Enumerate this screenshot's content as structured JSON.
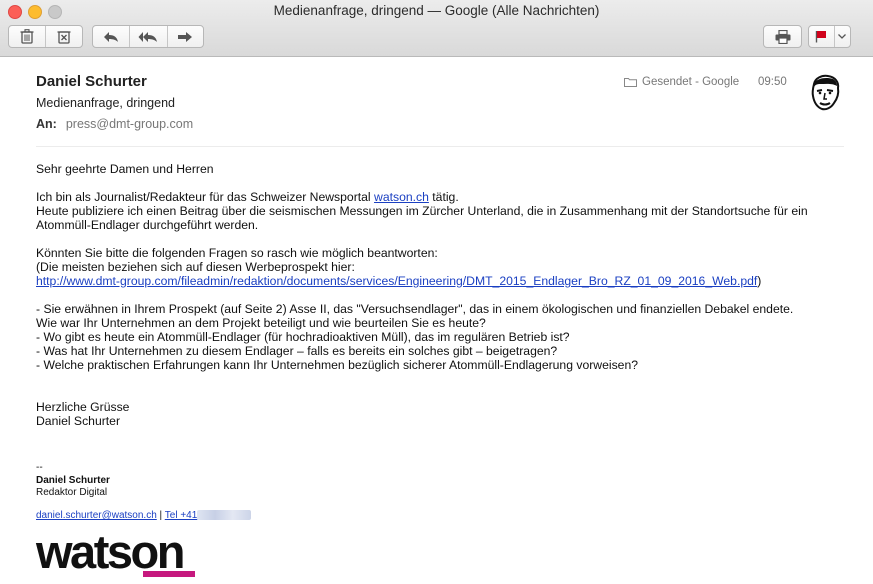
{
  "window": {
    "title": "Medienanfrage, dringend — Google (Alle Nachrichten)"
  },
  "toolbar": {
    "icons": [
      "trash-icon",
      "junk-icon",
      "reply-icon",
      "reply-all-icon",
      "forward-icon",
      "print-icon",
      "flag-icon",
      "chevron-down-icon"
    ],
    "flag_color": "#d0021b"
  },
  "header": {
    "sender": "Daniel Schurter",
    "subject": "Medienanfrage, dringend",
    "to_label": "An:",
    "to_value": "press@dmt-group.com",
    "mailbox": "Gesendet - Google",
    "time": "09:50"
  },
  "body": {
    "greeting": "Sehr geehrte Damen und Herren",
    "p1_prefix": "Ich bin als Journalist/Redakteur für das Schweizer Newsportal ",
    "p1_link": "watson.ch",
    "p1_suffix": " tätig.",
    "p1_line2": "Heute publiziere ich einen Beitrag über die seismischen Messungen im Zürcher Unterland, die in Zusammenhang mit der Standortsuche für ein",
    "p1_line3": "Atommüll-Endlager durchgeführt werden.",
    "p2_line1": "Könnten Sie bitte die folgenden Fragen so rasch wie möglich beantworten:",
    "p2_line2": "(Die meisten beziehen sich auf diesen Werbeprospekt hier:",
    "p2_link": "http://www.dmt-group.com/fileadmin/redaktion/documents/services/Engineering/DMT_2015_Endlager_Bro_RZ_01_09_2016_Web.pdf",
    "p2_close": ")",
    "q1": "- Sie erwähnen in Ihrem Prospekt (auf Seite 2) Asse II, das \"Versuchsendlager\", das in einem ökologischen und finanziellen Debakel endete.",
    "q1b": "Wie war Ihr Unternehmen an dem Projekt beteiligt und wie beurteilen Sie es heute?",
    "q2": "- Wo gibt es heute ein Atommüll-Endlager (für hochradioaktiven Müll), das im regulären Betrieb ist?",
    "q3": "- Was hat Ihr Unternehmen zu diesem Endlager – falls es bereits ein solches gibt – beigetragen?",
    "q4": "- Welche praktischen Erfahrungen kann Ihr Unternehmen bezüglich sicherer Atommüll-Endlagerung vorweisen?",
    "closing1": "Herzliche Grüsse",
    "closing2": "Daniel Schurter"
  },
  "signature": {
    "dashes": "--",
    "name": "Daniel Schurter",
    "role": "Redaktor Digital",
    "email": "daniel.schurter@watson.ch",
    "separator": " | ",
    "tel": "Tel +41",
    "logo": "watson",
    "logo_accent": "#c6187e"
  }
}
